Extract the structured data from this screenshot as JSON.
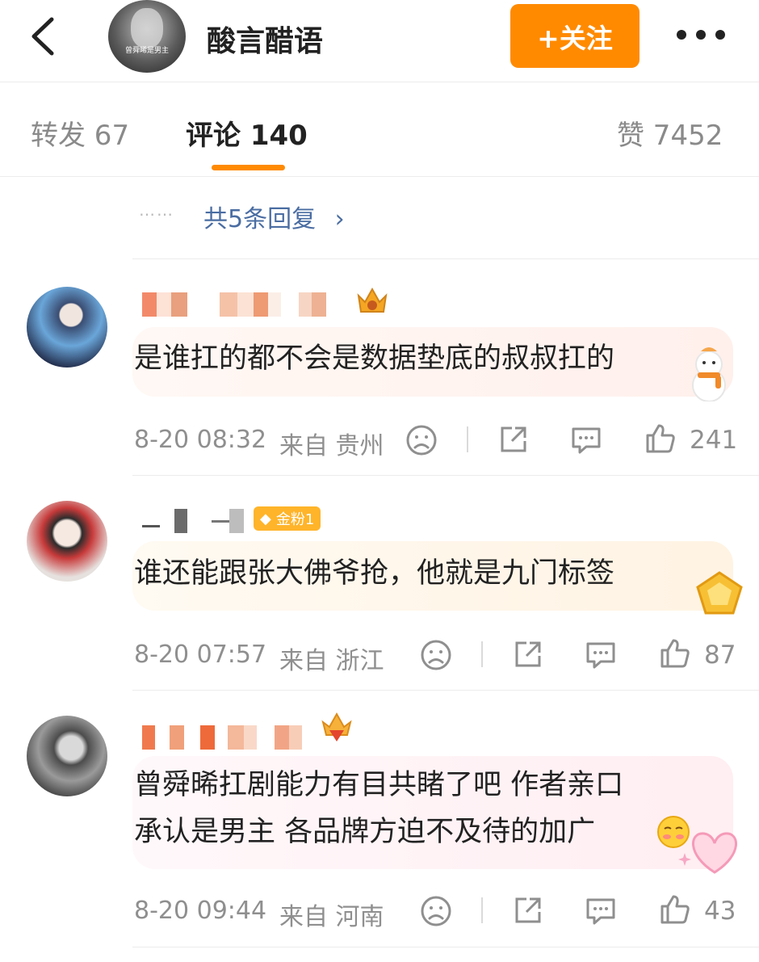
{
  "header": {
    "title": "酸言醋语",
    "follow_label": "+关注",
    "avatar_caption": "曾舜晞是男主"
  },
  "tabs": [
    {
      "label": "转发 67",
      "active": false
    },
    {
      "label": "评论 140",
      "active": true
    },
    {
      "label": "赞 7452",
      "active": false
    }
  ],
  "replies": {
    "dots": "……",
    "label": "共5条回复",
    "chevron": "›"
  },
  "comments": [
    {
      "text": "是谁扛的都不会是数据垫底的叔叔扛的",
      "date": "8-20 08:32",
      "location": "来自 贵州",
      "likes": "241",
      "bubble_color": "#fff4ef",
      "sticker": "snowman-icon"
    },
    {
      "badge": "金粉1",
      "text": "谁还能跟张大佛爷抢，他就是九门标签",
      "date": "8-20 07:57",
      "location": "来自 浙江",
      "likes": "87",
      "bubble_color": "#fff7ea",
      "sticker": "gold-medal-icon"
    },
    {
      "text_line1": "曾舜晞扛剧能力有目共睹了吧 作者亲口",
      "text_line2": "承认是男主 各品牌方迫不及待的加广",
      "date": "8-20 09:44",
      "location": "来自 河南",
      "likes": "43",
      "bubble_color": "#fff0f3",
      "sticker": "heart-icon"
    }
  ],
  "colors": {
    "accent": "#ff8a00",
    "link": "#4a6da2",
    "meta": "#8f8f8f"
  }
}
